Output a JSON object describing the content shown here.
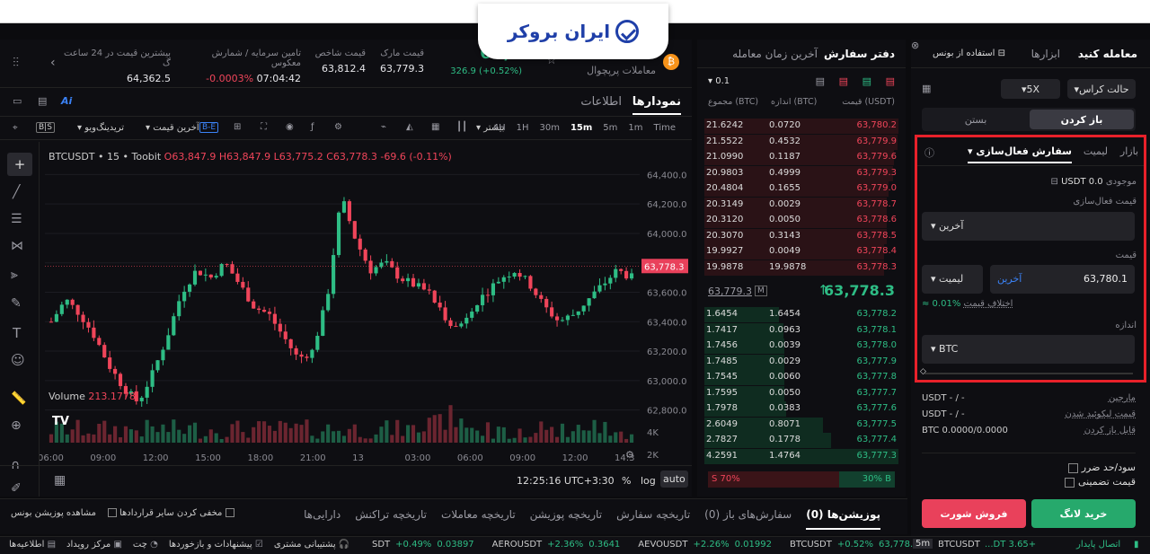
{
  "brand": {
    "name": "ایران بروکر"
  },
  "ticker": {
    "price": "63,7",
    "change": "326.9 (+0.52%)",
    "pair_label": "معاملات پرپچوال",
    "mark_label": "قیمت مارک",
    "mark_value": "63,779.3",
    "index_label": "قیمت شاخص",
    "index_value": "63,812.4",
    "funding_label": "تامین سرمایه / شمارش معکوس",
    "funding_rate": "-0.0003%",
    "funding_countdown": "07:04:42",
    "high_label": "بیشترین قیمت در 24 ساعت گ",
    "high_value": "64,362.5"
  },
  "chart_tabs": {
    "charts": "نمودارها",
    "info": "اطلاعات"
  },
  "timeframes": [
    "Time",
    "1m",
    "5m",
    "15m",
    "30m",
    "1H",
    "4H"
  ],
  "timeframe_active": "15m",
  "more": "بیشتر",
  "tradingview": "تریدینگ‌ویو",
  "last_price": "آخرین قیمت",
  "chart_legend": {
    "symbol": "BTCUSDT • 15 • Toobit",
    "o": "63,847.9",
    "h": "63,847.9",
    "l": "63,775.2",
    "c": "63,778.3",
    "chg": "-69.6 (-0.11%)"
  },
  "volume": {
    "label": "Volume",
    "value": "213.1778",
    "tag": "213.1778",
    "ticks": [
      "4K",
      "2K"
    ]
  },
  "chart_data": {
    "type": "candlestick",
    "y_ticks": [
      "64,400.0",
      "64,200.0",
      "64,000.0",
      "63,800.0",
      "63,600.0",
      "63,400.0",
      "63,200.0",
      "63,000.0",
      "62,800.0"
    ],
    "last_tag": "63,778.3",
    "x_ticks": [
      "06:00",
      "09:00",
      "12:00",
      "15:00",
      "18:00",
      "21:00",
      "13",
      "03:00",
      "06:00",
      "09:00",
      "12:00",
      "14:3"
    ],
    "ylim": [
      62700,
      64500
    ]
  },
  "chart_footer": {
    "time": "12:25:16 UTC+3:30",
    "pct": "%",
    "log": "log",
    "auto": "auto"
  },
  "orderbook": {
    "tab_book": "دفتر سفارش",
    "tab_trades": "آخرین زمان معامله",
    "precision": "0.1",
    "col_price": "قیمت (USDT)",
    "col_size": "اندازه (BTC)",
    "col_total": "مجموع (BTC)",
    "asks": [
      [
        "63,780.2",
        "0.0720",
        "21.6242"
      ],
      [
        "63,779.9",
        "0.4532",
        "21.5522"
      ],
      [
        "63,779.6",
        "0.1187",
        "21.0990"
      ],
      [
        "63,779.3",
        "0.4999",
        "20.9803"
      ],
      [
        "63,779.0",
        "0.1655",
        "20.4804"
      ],
      [
        "63,778.7",
        "0.0029",
        "20.3149"
      ],
      [
        "63,778.6",
        "0.0050",
        "20.3120"
      ],
      [
        "63,778.5",
        "0.3143",
        "20.3070"
      ],
      [
        "63,778.4",
        "0.0049",
        "19.9927"
      ],
      [
        "63,778.3",
        "19.9878",
        "19.9878"
      ]
    ],
    "last": "63,778.3",
    "mark": "63,779.3",
    "bids": [
      [
        "63,778.2",
        "1.6454",
        "1.6454"
      ],
      [
        "63,778.1",
        "0.0963",
        "1.7417"
      ],
      [
        "63,778.0",
        "0.0039",
        "1.7456"
      ],
      [
        "63,777.9",
        "0.0029",
        "1.7485"
      ],
      [
        "63,777.8",
        "0.0060",
        "1.7545"
      ],
      [
        "63,777.7",
        "0.0050",
        "1.7595"
      ],
      [
        "63,777.6",
        "0.0383",
        "1.7978"
      ],
      [
        "63,777.5",
        "0.8071",
        "2.6049"
      ],
      [
        "63,777.4",
        "0.1778",
        "2.7827"
      ],
      [
        "63,777.3",
        "1.4764",
        "4.2591"
      ]
    ],
    "sell_pct": "S 70%",
    "buy_pct": "30% B"
  },
  "trade": {
    "tab_trade": "معامله کنید",
    "tab_tools": "ابزارها",
    "tab_bonus": "استفاده از بونس",
    "margin_mode": "حالت کراس",
    "leverage": "5X",
    "open": "باز کردن",
    "close": "بستن",
    "type_market": "بازار",
    "type_limit": "لیمیت",
    "type_trigger": "سفارش فعال‌سازی",
    "balance_label": "موجودی",
    "balance": "0.0 USDT",
    "trigger_label": "قیمت فعال‌سازی",
    "trigger_select": "آخرین",
    "price_label": "قیمت",
    "price_type": "لیمیت",
    "price_hint": "آخرین",
    "price_value": "63,780.1",
    "diff_label": "اختلاف قیمت",
    "diff_value": "≈ 0.01%",
    "size_label": "اندازه",
    "size_unit": "BTC",
    "margin_label": "مارجین",
    "margin_value": "USDT  - / -",
    "liq_label": "قیمت لیکوئید شدن",
    "liq_value": "USDT  - / -",
    "avail_label": "قابل باز کردن",
    "avail_value": "BTC 0.0000/0.0000",
    "tpsl": "سود/حد ضرر",
    "guarantee": "قیمت تضمینی",
    "buy": "خرید لانگ",
    "sell": "فروش شورت",
    "highlight": "#e8212a"
  },
  "bottom": {
    "tabs": [
      "پوزیشن‌ها (0)",
      "سفارش‌های باز (0)",
      "تاریخچه سفارش",
      "تاریخچه پوزیشن",
      "تاریخچه معاملات",
      "تاریخچه تراکنش",
      "دارایی‌ها"
    ],
    "hide_label": "مخفی کردن سایر قراردادها",
    "bonus_label": "مشاهده پوزیشن بونس"
  },
  "status": {
    "support": "پشتیبانی مشتری",
    "feedback": "پیشنهادات و بازخوردها",
    "chat": "چت",
    "events": "مرکز رویداد",
    "notices": "اطلاعیه‌ها",
    "pairs": [
      [
        "SDT",
        "+0.49%",
        "0.03897"
      ],
      [
        "AEROUSDT",
        "+2.36%",
        "0.3641"
      ],
      [
        "AEVOUSDT",
        "+2.26%",
        "0.01992"
      ],
      [
        "BTCUSDT",
        "+0.52%",
        "63,778.3"
      ]
    ],
    "tf": "5m",
    "btc": "BTCUSDT",
    "stable": "اتصال پایدار",
    "extra": "...DT 3.65+"
  }
}
